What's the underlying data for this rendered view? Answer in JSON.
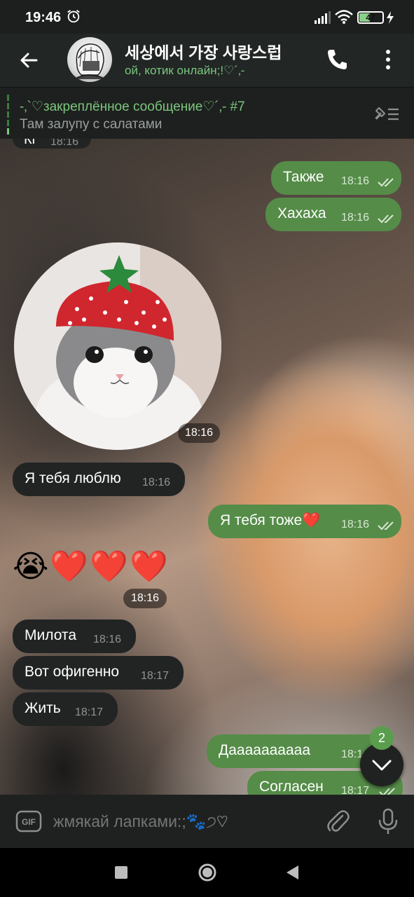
{
  "status_bar": {
    "time": "19:46",
    "battery_percent": "47",
    "battery_level": 0.47,
    "icons": [
      "alarm-icon",
      "signal-icon",
      "wifi-icon",
      "battery-icon",
      "charging-bolt-icon"
    ]
  },
  "header": {
    "title": "세상에서 가장 사랑스럽",
    "status": "ой, котик онлайн;!♡´‚-",
    "icons": [
      "back-arrow-icon",
      "phone-icon",
      "more-vertical-icon"
    ]
  },
  "pinned": {
    "title": "-‚`♡закреплённое сообщение♡´‚- #7",
    "text": "Там залупу с салатами",
    "icon": "pinned-list-icon"
  },
  "messages": {
    "partial_top": {
      "text": "Кі",
      "time": "18:16"
    },
    "m1": {
      "text": "Также",
      "time": "18:16",
      "direction": "out",
      "read": true
    },
    "m2": {
      "text": "Хахаха",
      "time": "18:16",
      "direction": "out",
      "read": true
    },
    "video_note": {
      "time": "18:16",
      "direction": "in"
    },
    "m3": {
      "text": "Я тебя люблю",
      "time": "18:16",
      "direction": "in"
    },
    "m4": {
      "text": "Я тебя тоже❤️",
      "time": "18:16",
      "direction": "out",
      "read": true
    },
    "emoji": {
      "text": "😭❤️❤️❤️",
      "time": "18:16",
      "direction": "in"
    },
    "m5": {
      "text": "Милота",
      "time": "18:16",
      "direction": "in"
    },
    "m6": {
      "text": "Вот офигенно",
      "time": "18:17",
      "direction": "in"
    },
    "m7": {
      "text": "Жить",
      "time": "18:17",
      "direction": "in"
    },
    "m8": {
      "text": "Даааааааааа",
      "time": "18:1",
      "direction": "out"
    },
    "m9": {
      "text": "Согласен",
      "time": "18:17",
      "direction": "out"
    }
  },
  "unread_count": "2",
  "input": {
    "placeholder": "жмякай лапками:;🐾੭♡",
    "icons": [
      "gif-icon",
      "attach-paperclip-icon",
      "microphone-icon"
    ]
  },
  "colors": {
    "outgoing_bubble": "#558c48",
    "incoming_bubble": "#222424",
    "accent": "#7bc77e",
    "header_bg": "#222625"
  }
}
